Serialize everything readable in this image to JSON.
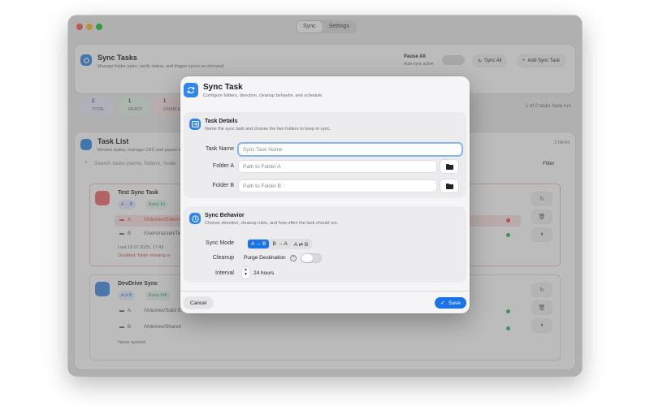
{
  "window": {
    "tabs": [
      {
        "label": "Sync",
        "active": true
      },
      {
        "label": "Settings",
        "active": false
      }
    ],
    "traffic_colors": [
      "#ff5f57",
      "#febc2e",
      "#28c840"
    ]
  },
  "background": {
    "header": {
      "title": "Sync Tasks",
      "subtitle": "Manage folder pairs, verify status, and trigger syncs on demand.",
      "pause_label": "Pause All",
      "pause_sub": "Auto-sync active",
      "sync_all": "Sync All",
      "add_task": "Add Sync Task"
    },
    "stats": [
      {
        "value": "2",
        "label": "TOTAL"
      },
      {
        "value": "1",
        "label": "READY"
      },
      {
        "value": "1",
        "label": "DISABLED"
      }
    ],
    "runs_text": "1 of 2 tasks have run",
    "task_list": {
      "title": "Task List",
      "subtitle": "Review status, manage CRC and pause st",
      "count": "2 items",
      "search_placeholder": "Search tasks (name, folders, mode",
      "filter": "Filter"
    },
    "tasks": [
      {
        "name": "Test Sync Task",
        "mode_badge": "A → B",
        "interval_badge": "Every 1h",
        "folder_a_key": "A",
        "folder_a": "/Volumes/Extern",
        "folder_b_key": "B",
        "folder_b": "/Users/razvan/Te",
        "last": "Last 19.07.2025, 17:43",
        "warning": "Disabled: folder missing or"
      },
      {
        "name": "DevDrive Sync",
        "mode_badge": "A ⇄ B",
        "interval_badge": "Every 24h",
        "folder_a_key": "A",
        "folder_a": "/Volumes/Solid S",
        "folder_b_key": "B",
        "folder_b": "/Volumes/Shared",
        "last": "Never synced"
      }
    ]
  },
  "modal": {
    "title": "Sync Task",
    "subtitle": "Configure folders, direction, cleanup behavior, and schedule.",
    "details": {
      "title": "Task Details",
      "subtitle": "Name the sync task and choose the two folders to keep in sync.",
      "name_label": "Task Name",
      "name_placeholder": "Sync Task Name",
      "folder_a_label": "Folder A",
      "folder_a_placeholder": "Path to Folder A",
      "folder_b_label": "Folder B",
      "folder_b_placeholder": "Path to Folder B"
    },
    "behavior": {
      "title": "Sync Behavior",
      "subtitle": "Choose direction, cleanup rules, and how often the task should run.",
      "mode_label": "Sync Mode",
      "modes": [
        {
          "label": "A → B",
          "selected": true
        },
        {
          "label": "B → A",
          "selected": false
        },
        {
          "label": "A ⇄ B",
          "selected": false
        }
      ],
      "cleanup_label": "Cleanup",
      "purge_label": "Purge Destination",
      "purge_on": false,
      "interval_label": "Interval",
      "interval_value": "24 hours"
    },
    "cancel": "Cancel",
    "save": "Save",
    "accent": "#1a74e8"
  }
}
